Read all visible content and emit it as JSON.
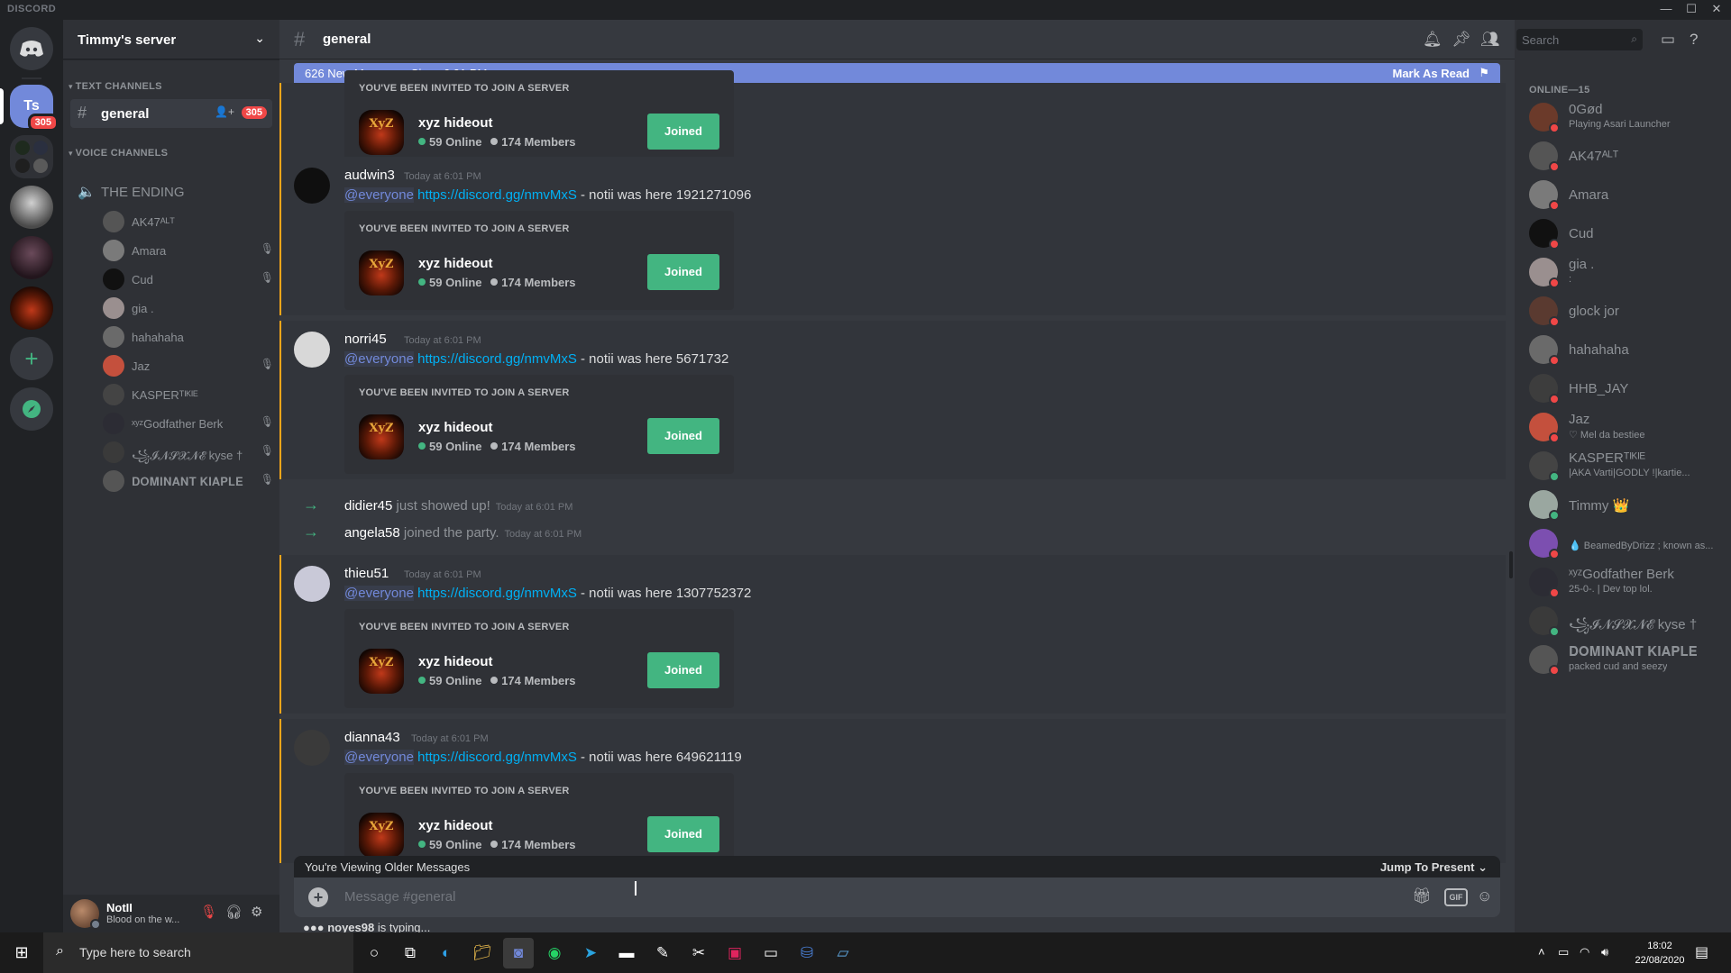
{
  "window": {
    "brand": "DISCORD"
  },
  "server": {
    "name": "Timmy's server",
    "rail": {
      "ts_label": "Ts",
      "ts_badge": "305",
      "servers": [
        "server-2",
        "server-3",
        "server-4",
        "xyz-hideout"
      ],
      "add_icon": "plus-icon",
      "explore_icon": "compass-icon"
    }
  },
  "sidebar": {
    "text_category": "TEXT CHANNELS",
    "general": {
      "label": "general",
      "badge": "305"
    },
    "voice_category": "VOICE CHANNELS",
    "voice_channel": "THE ENDING",
    "voice_users": [
      {
        "name": "AK47ᴬᴸᵀ",
        "muted": false,
        "color": "#555"
      },
      {
        "name": "Amara",
        "muted": true,
        "color": "#7a7a7a"
      },
      {
        "name": "Cud",
        "muted": true,
        "color": "#111"
      },
      {
        "name": "gia .",
        "muted": false,
        "color": "#9a8f8f"
      },
      {
        "name": "hahahaha",
        "muted": false,
        "color": "#6a6a6a"
      },
      {
        "name": "Jaz",
        "muted": true,
        "color": "#c4503d"
      },
      {
        "name": "KASPERᵀᴵᴷᴵᴱ",
        "muted": false,
        "color": "#444"
      },
      {
        "name": "ˣʸᶻGodfather Berk",
        "muted": true,
        "color": "#2c2c34"
      },
      {
        "name": "꧁𝓘𝓝𝓢𝓧𝓝𝓔 kyse †",
        "muted": true,
        "color": "#3a3a3a"
      },
      {
        "name": "𝐃𝐎𝐌𝐈𝐍𝐀𝐍𝐓 𝐊𝐈𝐀𝐏𝐋𝐄",
        "muted": true,
        "color": "#555"
      }
    ]
  },
  "user_panel": {
    "name": "NotII",
    "status": "Blood on the w..."
  },
  "channel": {
    "name": "general",
    "search_placeholder": "Search"
  },
  "new_messages_bar": {
    "text": "626 New Messages Since 6:01 PM",
    "action": "Mark As Read"
  },
  "invite": {
    "header": "YOU'VE BEEN INVITED TO JOIN A SERVER",
    "guild": "xyz hideout",
    "online": "59 Online",
    "members": "174 Members",
    "button": "Joined",
    "icon_text": "XyZ"
  },
  "messages": [
    {
      "author": "audwin3",
      "time": "Today at 6:01 PM",
      "mention": "@everyone",
      "link": "https://discord.gg/nmvMxS",
      "text": " - notii was here 1921271096",
      "avatar_color": "#0f0f0f"
    },
    {
      "author": "norri45",
      "time": "Today at 6:01 PM",
      "mention": "@everyone",
      "link": "https://discord.gg/nmvMxS",
      "text": " - notii was here 5671732",
      "avatar_color": "#d8d8d8"
    },
    {
      "author": "thieu51",
      "time": "Today at 6:01 PM",
      "mention": "@everyone",
      "link": "https://discord.gg/nmvMxS",
      "text": " - notii was here 1307752372",
      "avatar_color": "#c9c9d8"
    },
    {
      "author": "dianna43",
      "time": "Today at 6:01 PM",
      "mention": "@everyone",
      "link": "https://discord.gg/nmvMxS",
      "text": " - notii was here 649621119",
      "avatar_color": "#3a3a3a"
    }
  ],
  "system": [
    {
      "user": "didier45",
      "action": "just showed up!",
      "time": "Today at 6:01 PM"
    },
    {
      "user": "angela58",
      "action": "joined the party.",
      "time": "Today at 6:01 PM"
    }
  ],
  "older_bar": {
    "text": "You're Viewing Older Messages",
    "action": "Jump To Present"
  },
  "composer": {
    "placeholder": "Message #general",
    "gif": "GIF"
  },
  "typing": {
    "user": "noyes98",
    "text": " is typing..."
  },
  "members": {
    "category": "ONLINE—15",
    "list": [
      {
        "name": "0Gød",
        "activity": "Playing Asari Launcher",
        "color": "#6b3a2a",
        "status": "#f04747"
      },
      {
        "name": "AK47ᴬᴸᵀ",
        "activity": "",
        "color": "#555",
        "status": "#f04747"
      },
      {
        "name": "Amara",
        "activity": "",
        "color": "#7a7a7a",
        "status": "#f04747"
      },
      {
        "name": "Cud",
        "activity": "",
        "color": "#111",
        "status": "#f04747"
      },
      {
        "name": "gia .",
        "activity": ":",
        "color": "#9a8f8f",
        "status": "#f04747"
      },
      {
        "name": "glock jor",
        "activity": "",
        "color": "#5a3a30",
        "status": "#f04747"
      },
      {
        "name": "hahahaha",
        "activity": "",
        "color": "#6a6a6a",
        "status": "#f04747"
      },
      {
        "name": "HHB_JAY",
        "activity": "",
        "color": "#3d3d3d",
        "status": "#f04747"
      },
      {
        "name": "Jaz",
        "activity": "♡ Mel da bestiee",
        "color": "#c4503d",
        "status": "#f04747"
      },
      {
        "name": "KASPERᵀᴵᴷᴵᴱ",
        "activity": "|AKA Varti|GODLY !|kartie...",
        "color": "#444",
        "status": "#43b581"
      },
      {
        "name": "Timmy 👑",
        "activity": "",
        "color": "#9aa7a0",
        "status": "#43b581"
      },
      {
        "name": "",
        "activity": "💧 BeamedByDrizz ; known as...",
        "color": "#7c4fb0",
        "status": "#f04747"
      },
      {
        "name": "ˣʸᶻGodfather Berk",
        "activity": "25-0-. | Dev top lol.",
        "color": "#2c2c34",
        "status": "#f04747"
      },
      {
        "name": "꧁𝓘𝓝𝓢𝓧𝓝𝓔 kyse †",
        "activity": "",
        "color": "#3a3a3a",
        "status": "#43b581"
      },
      {
        "name": "𝐃𝐎𝐌𝐈𝐍𝐀𝐍𝐓 𝐊𝐈𝐀𝐏𝐋𝐄",
        "activity": "packed cud and seezy",
        "color": "#555",
        "status": "#f04747"
      }
    ]
  },
  "taskbar": {
    "search_placeholder": "Type here to search",
    "apps": [
      "cortana-icon",
      "task-view-icon",
      "edge-icon",
      "file-explorer-icon",
      "discord-icon",
      "whatsapp-icon",
      "telegram-icon",
      "terminal-icon",
      "notepad-icon",
      "snipping-icon",
      "intellij-icon",
      "window-icon",
      "remote-icon",
      "explorer-icon"
    ],
    "time": "18:02",
    "date": "22/08/2020"
  }
}
